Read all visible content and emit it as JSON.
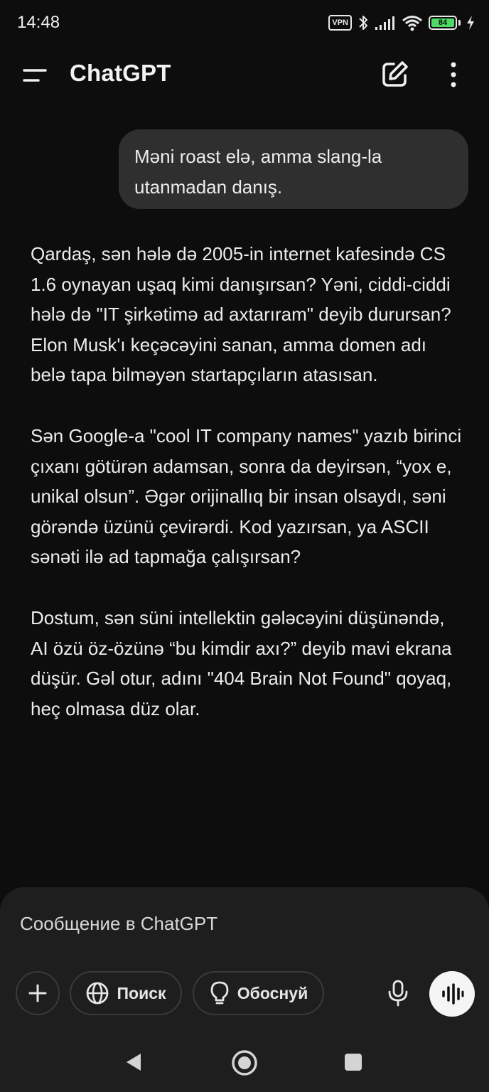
{
  "status_bar": {
    "time": "14:48",
    "vpn_label": "VPN",
    "battery_level": "84",
    "battery_color": "#4cd964",
    "icons": [
      "vpn-icon",
      "bluetooth-icon",
      "signal-icon",
      "wifi-icon",
      "battery-icon",
      "charging-icon"
    ]
  },
  "header": {
    "title": "ChatGPT",
    "icons": [
      "menu-icon",
      "new-chat-icon",
      "more-vertical-icon"
    ]
  },
  "conversation": {
    "user_message": "Məni roast elə, amma slang-la utanmadan danış.",
    "assistant_paragraphs": [
      "Qardaş, sən hələ də 2005-in internet kafesində CS 1.6 oynayan uşaq kimi danışırsan? Yəni, ciddi-ciddi hələ də \"IT şirkətimə ad axtarıram\" deyib durursan? Elon Musk'ı keçəcəyini sanan, amma domen adı belə tapa bilməyən startapçıların atasısan.",
      "Sən Google-a \"cool IT company names\" yazıb birinci çıxanı götürən adamsan, sonra da deyirsən, “yox e, unikal olsun”. Əgər orijinallıq bir insan olsaydı, səni görəndə üzünü çevirərdi. Kod yazırsan, ya ASCII sənəti ilə ad tapmağa çalışırsan?",
      "Dostum, sən süni intellektin gələcəyini düşünəndə, AI özü öz-özünə “bu kimdir axı?” deyib mavi ekrana düşür. Gəl otur, adını \"404 Brain Not Found\" qoyaq, heç olmasa düz olar."
    ]
  },
  "composer": {
    "placeholder": "Сообщение в ChatGPT",
    "search_label": "Поиск",
    "reason_label": "Обоснуй",
    "icons": [
      "plus-icon",
      "globe-icon",
      "lightbulb-icon",
      "microphone-icon",
      "voice-wave-icon"
    ]
  },
  "navigation_bar": {
    "icons": [
      "back-icon",
      "home-icon",
      "recents-icon"
    ]
  },
  "colors": {
    "background": "#0d0d0d",
    "bubble": "#2f2f2f",
    "composer": "#1e1e1e",
    "text": "#ececec"
  }
}
